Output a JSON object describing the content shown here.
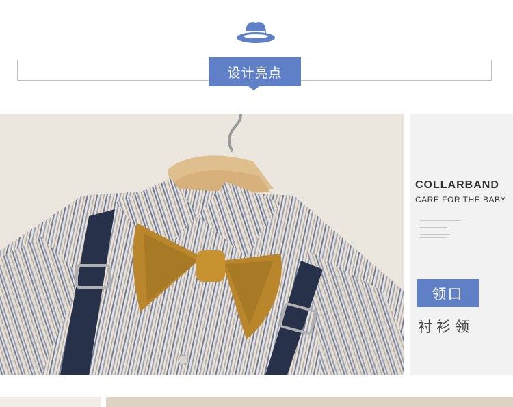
{
  "header": {
    "icon": "hat-icon",
    "section_title": "设计亮点"
  },
  "side_panel": {
    "title": "COLLARBAND",
    "subtitle": "CARE FOR THE BABY",
    "tag_label": "领口",
    "tag_sub": "衬衫领"
  },
  "colors": {
    "accent": "#5f7fc7",
    "bow": "#b9862b",
    "suspender": "#27324a"
  }
}
